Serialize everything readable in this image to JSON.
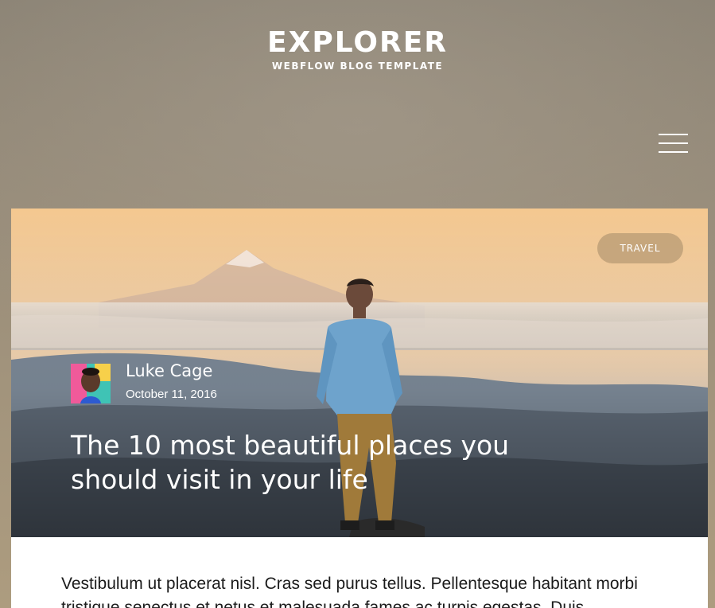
{
  "header": {
    "logo_title": "EXPLORER",
    "logo_subtitle": "WEBFLOW BLOG TEMPLATE"
  },
  "icons": {
    "menu": "hamburger-menu-icon"
  },
  "post": {
    "category": "TRAVEL",
    "author": "Luke Cage",
    "date": "October 11, 2016",
    "title": "The 10 most beautiful places you should visit in your life",
    "body": "Vestibulum ut placerat nisl. Cras sed purus tellus. Pellentesque habitant morbi tristique senectus et netus et malesuada fames ac turpis egestas. Duis"
  },
  "colors": {
    "badge_bg": "#bea078",
    "text_white": "#ffffff",
    "body_text": "#1b1b1b"
  }
}
